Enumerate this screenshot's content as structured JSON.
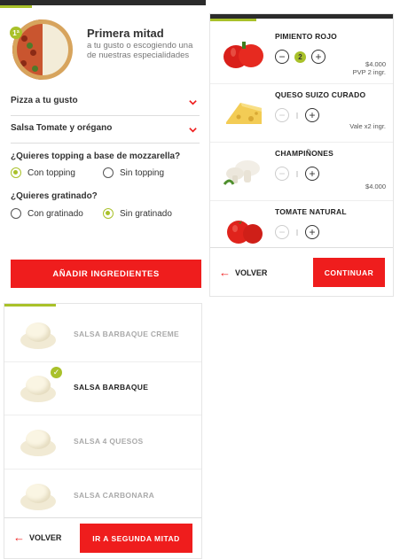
{
  "panel1": {
    "half_badge": "1ª",
    "title": "Primera mitad",
    "description": "a tu gusto o escogiendo una de nuestras especialidades",
    "select_pizza": "Pizza a tu gusto",
    "select_sauce": "Salsa Tomate y orégano",
    "q_mozzarella": "¿Quieres topping a base de mozzarella?",
    "opt_con_topping": "Con topping",
    "opt_sin_topping": "Sin topping",
    "q_gratinado": "¿Quieres gratinado?",
    "opt_con_gratinado": "Con gratinado",
    "opt_sin_gratinado": "Sin gratinado",
    "add_button": "AÑADIR INGREDIENTES"
  },
  "panel2": {
    "ingredients": [
      {
        "name": "PIMIENTO ROJO",
        "qty": "2",
        "price": "$4.000",
        "note": "PVP 2 ingr."
      },
      {
        "name": "QUESO SUIZO CURADO",
        "qty": "",
        "price": "",
        "note": "Vale x2 ingr."
      },
      {
        "name": "CHAMPIÑONES",
        "qty": "",
        "price": "$4.000",
        "note": ""
      },
      {
        "name": "TOMATE NATURAL",
        "qty": "",
        "price": "",
        "note": ""
      }
    ],
    "back_label": "VOLVER",
    "continue_label": "CONTINUAR"
  },
  "panel3": {
    "sauces": [
      {
        "name": "SALSA BARBAQUE CREME",
        "selected": false
      },
      {
        "name": "SALSA BARBAQUE",
        "selected": true
      },
      {
        "name": "SALSA 4 QUESOS",
        "selected": false
      },
      {
        "name": "SALSA CARBONARA",
        "selected": false
      }
    ],
    "back_label": "VOLVER",
    "next_label": "IR A SEGUNDA MITAD"
  },
  "colors": {
    "accent": "#a9c12a",
    "brand_red": "#ef1d1d"
  }
}
